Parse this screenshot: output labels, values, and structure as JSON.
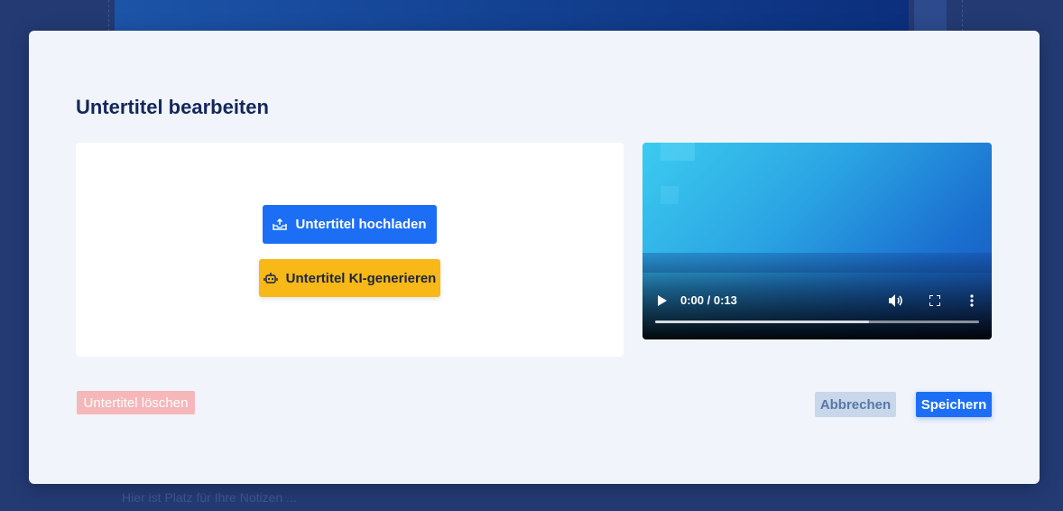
{
  "background": {
    "notes_placeholder": "Hier ist Platz für Ihre Notizen ..."
  },
  "modal": {
    "title": "Untertitel bearbeiten",
    "upload_button_label": "Untertitel hochladen",
    "upload_button_icon": "upload-tray-icon",
    "ai_button_label": "Untertitel KI-generieren",
    "ai_button_icon": "robot-icon",
    "delete_button_label": "Untertitel löschen",
    "cancel_button_label": "Abbrechen",
    "save_button_label": "Speichern"
  },
  "video": {
    "time_display": "0:00 / 0:13",
    "buffered_fraction": 0.66
  },
  "colors": {
    "primary": "#1c6ff4",
    "ai_accent": "#f7b818",
    "title": "#13275a",
    "danger_disabled": "#f5b7b9"
  }
}
